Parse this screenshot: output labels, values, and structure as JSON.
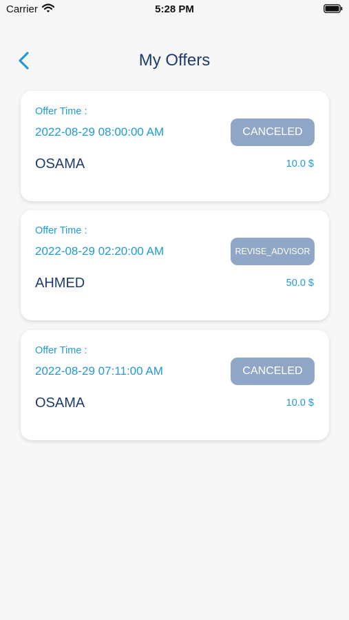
{
  "status_bar": {
    "carrier": "Carrier",
    "time": "5:28 PM"
  },
  "header": {
    "title": "My Offers"
  },
  "offers": [
    {
      "label": "Offer Time :",
      "time": "2022-08-29 08:00:00 AM",
      "status": "CANCELED",
      "name": "OSAMA",
      "price": "10.0 $"
    },
    {
      "label": "Offer Time :",
      "time": "2022-08-29 02:20:00 AM",
      "status": "REVISE_ADVISOR",
      "name": "AHMED",
      "price": "50.0 $"
    },
    {
      "label": "Offer Time :",
      "time": "2022-08-29 07:11:00 AM",
      "status": "CANCELED",
      "name": "OSAMA",
      "price": "10.0 $"
    }
  ],
  "colors": {
    "accent": "#1f9ad9",
    "title": "#1d3b6e",
    "badge": "#8fa6c7",
    "background": "#f7f7f8"
  },
  "icons": {
    "back": "chevron-left-icon",
    "wifi": "wifi-icon",
    "battery": "battery-icon"
  }
}
